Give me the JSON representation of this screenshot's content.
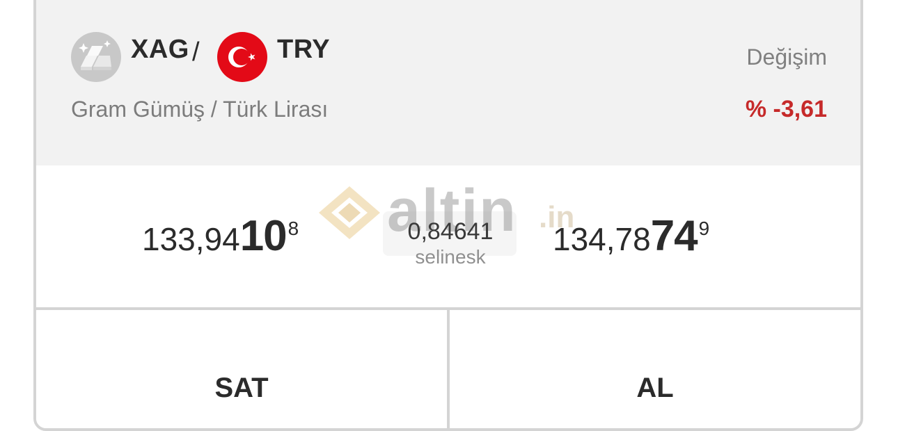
{
  "pair": {
    "base_code": "XAG",
    "separator": "/",
    "quote_code": "TRY",
    "name": "Gram Gümüş / Türk Lirası",
    "base_icon": "silver-bars-icon",
    "quote_icon": "turkey-flag-icon"
  },
  "change": {
    "label": "Değişim",
    "value": "% -3,61",
    "color": "#c62a2a"
  },
  "sell_price": {
    "main": "133,94",
    "big": "10",
    "small": "8"
  },
  "buy_price": {
    "main": "134,78",
    "big": "74",
    "small": "9"
  },
  "spread": {
    "value": "0,84641",
    "source": "selinesk"
  },
  "watermark": {
    "brand": "altin",
    "tld": ".in"
  },
  "actions": {
    "sell_label": "SAT",
    "buy_label": "AL"
  }
}
